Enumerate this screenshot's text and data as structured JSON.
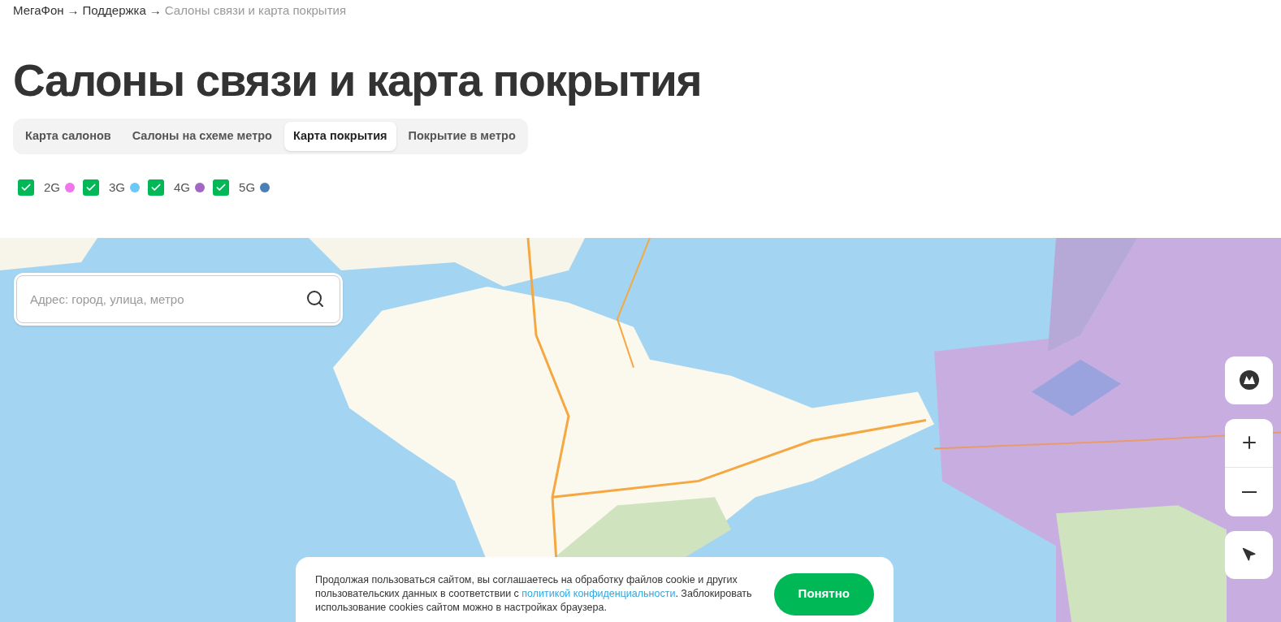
{
  "breadcrumbs": [
    {
      "label": "МегаФон",
      "current": false
    },
    {
      "label": "Поддержка",
      "current": false
    },
    {
      "label": "Салоны связи и карта покрытия",
      "current": true
    }
  ],
  "breadcrumb_separator": "→",
  "title": "Салоны связи и карта покрытия",
  "tabs": [
    {
      "label": "Карта салонов",
      "selected": false
    },
    {
      "label": "Салоны на схеме метро",
      "selected": false
    },
    {
      "label": "Карта покрытия",
      "selected": true
    },
    {
      "label": "Покрытие в метро",
      "selected": false
    }
  ],
  "filters": [
    {
      "label": "2G",
      "checked": true,
      "color": "#ee77ee"
    },
    {
      "label": "3G",
      "checked": true,
      "color": "#6cc8f8"
    },
    {
      "label": "4G",
      "checked": true,
      "color": "#a267c4"
    },
    {
      "label": "5G",
      "checked": true,
      "color": "#4a7fb8"
    }
  ],
  "map": {
    "kind": "picture",
    "search": {
      "placeholder": "Адрес: город, улица, метро"
    }
  },
  "cookie_notice": {
    "text_before": "Продолжая пользоваться сайтом, вы соглашаетесь на обработку файлов cookie и других пользовательских данных в соответствии с ",
    "link": "политикой конфиденциальности",
    "text_after": ". Заблокировать использование cookies сайтом можно в настройках браузера.",
    "button": "Понятно"
  }
}
